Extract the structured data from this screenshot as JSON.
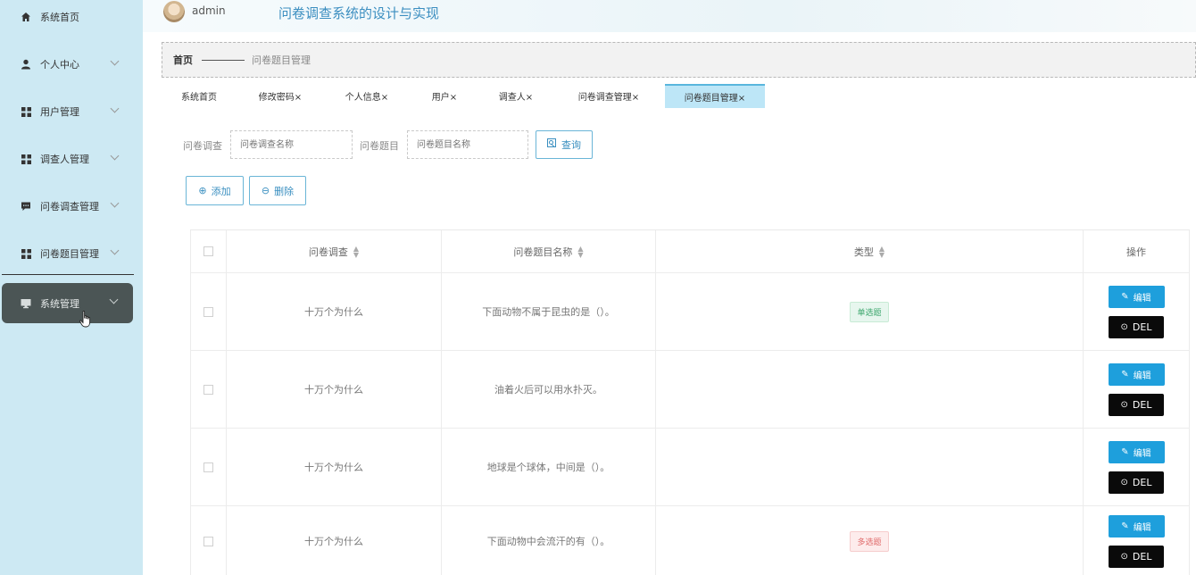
{
  "sidebar": {
    "items": [
      {
        "label": "系统首页",
        "icon": "home-icon"
      },
      {
        "label": "个人中心",
        "icon": "user-icon"
      },
      {
        "label": "用户管理",
        "icon": "grid-icon"
      },
      {
        "label": "调查人管理",
        "icon": "grid-icon"
      },
      {
        "label": "问卷调查管理",
        "icon": "comment-icon"
      },
      {
        "label": "问卷题目管理",
        "icon": "grid-icon"
      },
      {
        "label": "系统管理",
        "icon": "monitor-icon"
      }
    ]
  },
  "header": {
    "username": "admin",
    "title": "问卷调查系统的设计与实现"
  },
  "breadcrumb": {
    "home": "首页",
    "current": "问卷题目管理"
  },
  "tabs": [
    {
      "label": "系统首页"
    },
    {
      "label": "修改密码×"
    },
    {
      "label": "个人信息×"
    },
    {
      "label": "用户×"
    },
    {
      "label": "调查人×"
    },
    {
      "label": "问卷调查管理×"
    },
    {
      "label": "问卷题目管理×"
    }
  ],
  "search": {
    "survey_label": "问卷调查",
    "survey_placeholder": "问卷调查名称",
    "question_label": "问卷题目",
    "question_placeholder": "问卷题目名称",
    "query_button": "查询"
  },
  "actions": {
    "add": "添加",
    "delete": "删除"
  },
  "table": {
    "columns": [
      "问卷调查",
      "问卷题目名称",
      "类型",
      "操作"
    ],
    "rows": [
      {
        "survey": "十万个为什么",
        "question": "下面动物不属于昆虫的是（）。",
        "type": "单选题"
      },
      {
        "survey": "十万个为什么",
        "question": "油着火后可以用水扑灭。",
        "type": ""
      },
      {
        "survey": "十万个为什么",
        "question": "地球是个球体，中间是（）。",
        "type": ""
      },
      {
        "survey": "十万个为什么",
        "question": "下面动物中会流汗的有（）。",
        "type": "多选题"
      }
    ],
    "edit_label": "编辑",
    "del_label": "DEL"
  },
  "colors": {
    "sidebar_bg": "#cde9f3",
    "active_nav": "#4b5555",
    "accent": "#1e9fdc",
    "del_button": "#0a0a0a"
  }
}
